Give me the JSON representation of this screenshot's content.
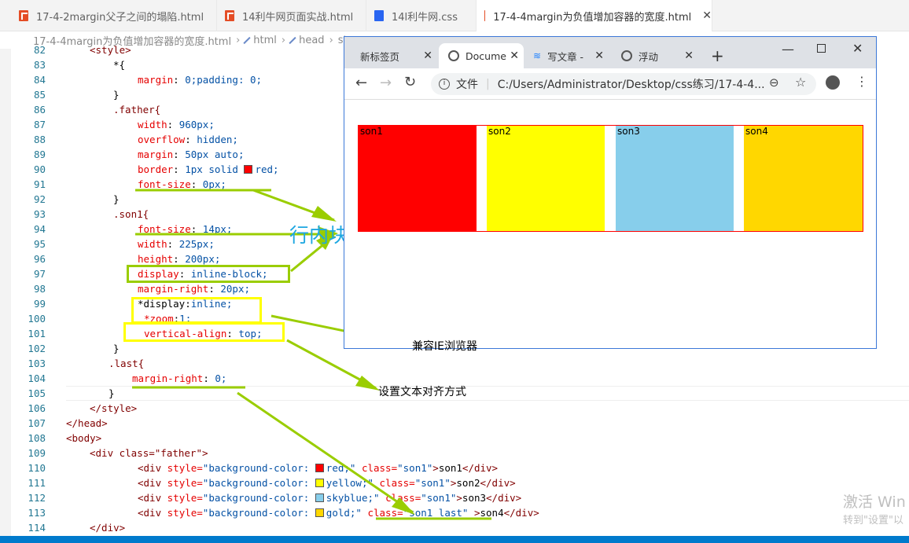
{
  "editor_tabs": [
    {
      "label": "17-4-2margin父子之间的塌陷.html",
      "type": "html"
    },
    {
      "label": "14利牛网页面实战.html",
      "type": "html"
    },
    {
      "label": "14l利牛网.css",
      "type": "css"
    },
    {
      "label": "17-4-4margin为负值增加容器的宽度.html",
      "type": "html",
      "active": true
    }
  ],
  "breadcrumb": [
    "17-4-4margin为负值增加容器的宽度.html",
    "html",
    "head",
    "st"
  ],
  "code_lines": [
    {
      "n": "82",
      "text": "<style>"
    },
    {
      "n": "83",
      "text": "*{"
    },
    {
      "n": "84",
      "prop": "margin",
      "val": "0;padding: 0;"
    },
    {
      "n": "85",
      "text": "}"
    },
    {
      "n": "86",
      "text": ".father{"
    },
    {
      "n": "87",
      "prop": "width",
      "val": "960px;"
    },
    {
      "n": "88",
      "prop": "overflow",
      "val": "hidden;"
    },
    {
      "n": "89",
      "prop": "margin",
      "val": "50px auto;"
    },
    {
      "n": "90",
      "prop": "border",
      "val": "1px solid",
      "val2": "red;"
    },
    {
      "n": "91",
      "prop": "font-size",
      "val": "0px;"
    },
    {
      "n": "92",
      "text": "}"
    },
    {
      "n": "93",
      "text": ".son1{"
    },
    {
      "n": "94",
      "prop": "font-size",
      "val": "14px;"
    },
    {
      "n": "95",
      "prop": "width",
      "val": "225px;"
    },
    {
      "n": "96",
      "prop": "height",
      "val": "200px;"
    },
    {
      "n": "97",
      "prop": "display",
      "val": "inline-block;"
    },
    {
      "n": "98",
      "prop": "margin-right",
      "val": "20px;"
    },
    {
      "n": "99",
      "prop": "*display",
      "val": "inline;"
    },
    {
      "n": "100",
      "prop": "*zoom",
      "val": "1;"
    },
    {
      "n": "101",
      "prop": "vertical-align",
      "val": "top;"
    },
    {
      "n": "102",
      "text": "}"
    },
    {
      "n": "103",
      "text": ".last{"
    },
    {
      "n": "104",
      "prop": "margin-right",
      "val": "0;"
    },
    {
      "n": "105",
      "text": "}"
    },
    {
      "n": "106",
      "text": "</style>"
    },
    {
      "n": "107",
      "text": "</head>"
    },
    {
      "n": "108",
      "text": "<body>"
    },
    {
      "n": "109",
      "text": "<div class=\"father\">"
    },
    {
      "n": "110",
      "color": "red",
      "cls": "son1",
      "content": "son1"
    },
    {
      "n": "111",
      "color": "yellow",
      "cls": "son1",
      "content": "son2"
    },
    {
      "n": "112",
      "color": "skyblue",
      "cls": "son1",
      "content": "son3"
    },
    {
      "n": "113",
      "color": "gold",
      "cls": "son1 last",
      "content": "son4"
    },
    {
      "n": "114",
      "text": "</div>"
    }
  ],
  "code_strings": {
    "div_open": "<div ",
    "style_attr": "style=",
    "bg_prefix": "\"background-color: ",
    "class_attr": "class=",
    "div_close": "</div>"
  },
  "annotations": {
    "inline_block_method": "行内块方法",
    "ie_compat": "兼容IE浏览器",
    "text_align": "设置文本对齐方式"
  },
  "browser": {
    "tabs": [
      "新标签页",
      "Docume",
      "写文章 -",
      "浮动"
    ],
    "new_tab": "+",
    "address_label": "文件",
    "address": "C:/Users/Administrator/Desktop/css练习/17-4-4...",
    "boxes": [
      {
        "label": "son1",
        "color": "#ff0000"
      },
      {
        "label": "son2",
        "color": "#ffff00"
      },
      {
        "label": "son3",
        "color": "#87ceeb"
      },
      {
        "label": "son4",
        "color": "#ffd700"
      }
    ],
    "father_border_color": "#ff0000"
  },
  "watermark": {
    "line1": "激活 Win",
    "line2": "转到\"设置\"以"
  },
  "colors": {
    "accent": "#007acc",
    "annotation_green": "#9acd00",
    "annotation_yellow": "#ffff00",
    "annotation_text": "#1ea7e1"
  }
}
